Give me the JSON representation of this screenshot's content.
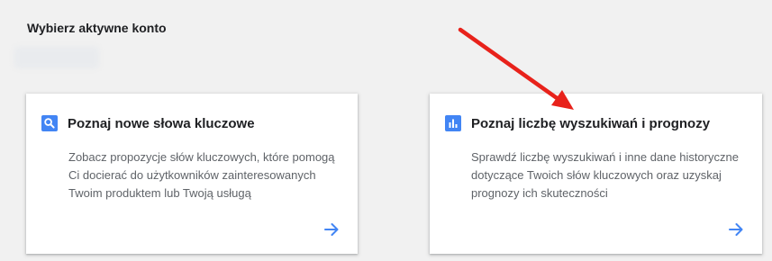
{
  "page": {
    "heading": "Wybierz aktywne konto"
  },
  "cards": [
    {
      "icon": "search-icon",
      "title": "Poznaj nowe słowa kluczowe",
      "description": "Zobacz propozycje słów kluczowych, które pomogą Ci docierać do użytkowników zainteresowanych Twoim produktem lub Twoją usługą",
      "action_icon": "arrow-right-icon"
    },
    {
      "icon": "bar-chart-icon",
      "title": "Poznaj liczbę wyszukiwań i prognozy",
      "description": "Sprawdź liczbę wyszukiwań i inne dane historyczne dotyczące Twoich słów kluczowych oraz uzyskaj prognozy ich skuteczności",
      "action_icon": "arrow-right-icon"
    }
  ],
  "colors": {
    "background": "#f1f1f1",
    "accent_blue": "#4285f4",
    "annotation_red": "#e8221b"
  }
}
